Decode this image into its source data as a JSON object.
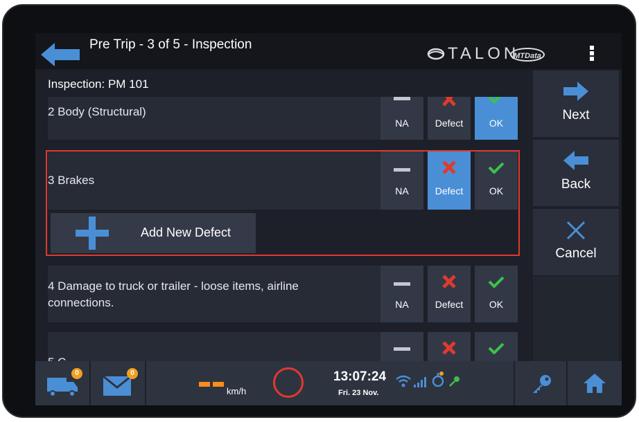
{
  "header": {
    "title": "Pre Trip - 3 of 5 - Inspection",
    "brand": "TALON",
    "partner_logo": "MTData",
    "back_icon": "back-arrow-icon",
    "menu_icon": "kebab-menu-icon"
  },
  "subtitle": "Inspection: PM 101",
  "options": {
    "na": "NA",
    "defect": "Defect",
    "ok": "OK"
  },
  "items": [
    {
      "label": "2 Body (Structural)",
      "selected": "ok"
    },
    {
      "label": "3 Brakes",
      "selected": "defect"
    },
    {
      "label": "4 Damage to truck or trailer - loose items, airline connections.",
      "selected": "none"
    },
    {
      "label": "5 C",
      "selected": "none"
    }
  ],
  "add_defect_label": "Add New Defect",
  "nav": {
    "next": "Next",
    "back": "Back",
    "cancel": "Cancel"
  },
  "status_bar": {
    "truck_badge": "0",
    "mail_badge": "0",
    "speed_unit": "km/h",
    "time": "13:07:24",
    "date": "Fri. 23 Nov."
  },
  "colors": {
    "selected": "#4a8fd6",
    "defect_red": "#e0392e",
    "ok_green": "#3cc24a",
    "accent_blue": "#4a8fd6",
    "speed_orange": "#ff8c1a",
    "badge_orange": "#f0a020",
    "highlight_border": "#e0392e"
  }
}
